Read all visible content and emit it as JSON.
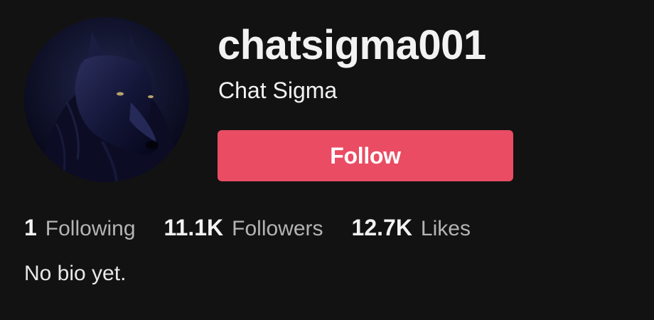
{
  "profile": {
    "username": "chatsigma001",
    "display_name": "Chat Sigma",
    "avatar_icon": "wolf-avatar",
    "bio": "No bio yet."
  },
  "actions": {
    "follow_label": "Follow",
    "follow_color": "#ea4c64"
  },
  "stats": [
    {
      "value": "1",
      "label": "Following"
    },
    {
      "value": "11.1K",
      "label": "Followers"
    },
    {
      "value": "12.7K",
      "label": "Likes"
    }
  ],
  "theme": {
    "background": "#121212",
    "text": "#f2f2f2",
    "muted_text": "#b4b4b4"
  }
}
